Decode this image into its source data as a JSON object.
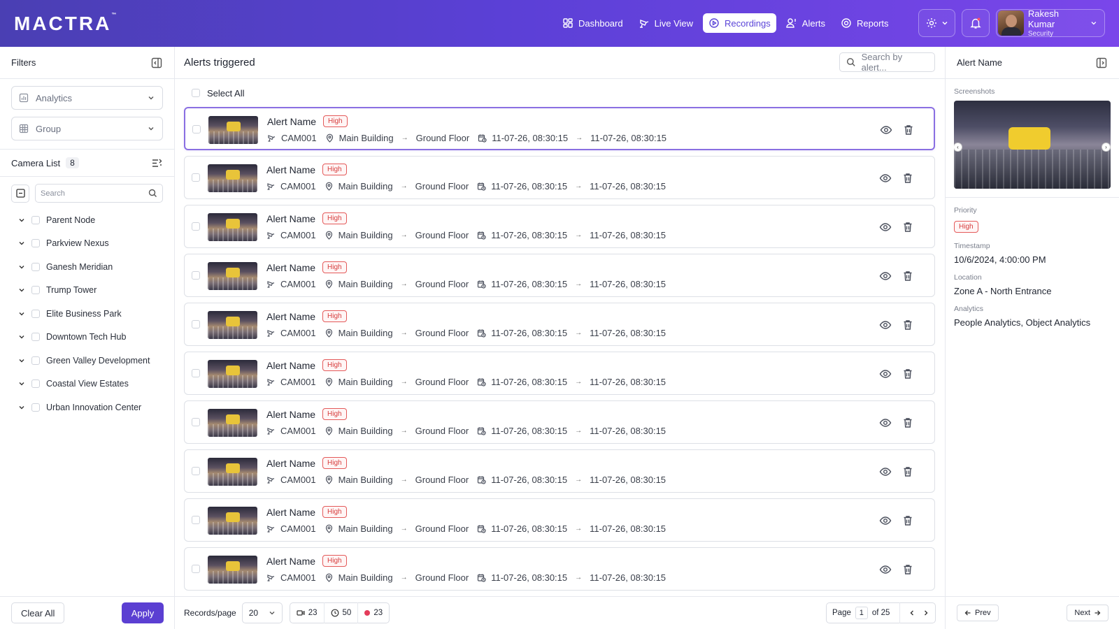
{
  "brand": {
    "logo": "MACTRA",
    "tm": "™"
  },
  "nav": [
    {
      "label": "Dashboard",
      "icon": "dashboard-icon"
    },
    {
      "label": "Live View",
      "icon": "camera-icon"
    },
    {
      "label": "Recordings",
      "icon": "play-circle-icon",
      "active": true
    },
    {
      "label": "Alerts",
      "icon": "user-alert-icon"
    },
    {
      "label": "Reports",
      "icon": "target-icon"
    }
  ],
  "user": {
    "name": "Rakesh Kumar",
    "role": "Security"
  },
  "filters": {
    "title": "Filters",
    "analytics_label": "Analytics",
    "group_label": "Group",
    "camera_list_label": "Camera List",
    "camera_count": "8",
    "search_placeholder": "Search",
    "tree": [
      "Parent Node",
      "Parkview Nexus",
      "Ganesh Meridian",
      "Trump Tower",
      "Elite Business Park",
      "Downtown Tech Hub",
      "Green Valley Development",
      "Coastal View Estates",
      "Urban Innovation Center"
    ],
    "clear_label": "Clear All",
    "apply_label": "Apply"
  },
  "main": {
    "title": "Alerts triggered",
    "search_placeholder": "Search by alert...",
    "select_all": "Select All",
    "alerts": [
      {
        "name": "Alert Name",
        "priority": "High",
        "camera": "CAM001",
        "building": "Main Building",
        "floor": "Ground Floor",
        "start": "11-07-26, 08:30:15",
        "end": "11-07-26, 08:30:15"
      },
      {
        "name": "Alert Name",
        "priority": "High",
        "camera": "CAM001",
        "building": "Main Building",
        "floor": "Ground Floor",
        "start": "11-07-26, 08:30:15",
        "end": "11-07-26, 08:30:15"
      },
      {
        "name": "Alert Name",
        "priority": "High",
        "camera": "CAM001",
        "building": "Main Building",
        "floor": "Ground Floor",
        "start": "11-07-26, 08:30:15",
        "end": "11-07-26, 08:30:15"
      },
      {
        "name": "Alert Name",
        "priority": "High",
        "camera": "CAM001",
        "building": "Main Building",
        "floor": "Ground Floor",
        "start": "11-07-26, 08:30:15",
        "end": "11-07-26, 08:30:15"
      },
      {
        "name": "Alert Name",
        "priority": "High",
        "camera": "CAM001",
        "building": "Main Building",
        "floor": "Ground Floor",
        "start": "11-07-26, 08:30:15",
        "end": "11-07-26, 08:30:15"
      },
      {
        "name": "Alert Name",
        "priority": "High",
        "camera": "CAM001",
        "building": "Main Building",
        "floor": "Ground Floor",
        "start": "11-07-26, 08:30:15",
        "end": "11-07-26, 08:30:15"
      },
      {
        "name": "Alert Name",
        "priority": "High",
        "camera": "CAM001",
        "building": "Main Building",
        "floor": "Ground Floor",
        "start": "11-07-26, 08:30:15",
        "end": "11-07-26, 08:30:15"
      },
      {
        "name": "Alert Name",
        "priority": "High",
        "camera": "CAM001",
        "building": "Main Building",
        "floor": "Ground Floor",
        "start": "11-07-26, 08:30:15",
        "end": "11-07-26, 08:30:15"
      },
      {
        "name": "Alert Name",
        "priority": "High",
        "camera": "CAM001",
        "building": "Main Building",
        "floor": "Ground Floor",
        "start": "11-07-26, 08:30:15",
        "end": "11-07-26, 08:30:15"
      },
      {
        "name": "Alert Name",
        "priority": "High",
        "camera": "CAM001",
        "building": "Main Building",
        "floor": "Ground Floor",
        "start": "11-07-26, 08:30:15",
        "end": "11-07-26, 08:30:15"
      }
    ],
    "footer": {
      "records_label": "Records/page",
      "records_value": "20",
      "stat_cameras": "23",
      "stat_clock": "50",
      "stat_live": "23",
      "page_label": "Page",
      "page_value": "1",
      "of_label": "of 25"
    }
  },
  "detail": {
    "title": "Alert Name",
    "screenshots_label": "Screenshots",
    "priority_label": "Priority",
    "priority_value": "High",
    "timestamp_label": "Timestamp",
    "timestamp_value": "10/6/2024, 4:00:00 PM",
    "location_label": "Location",
    "location_value": "Zone A - North Entrance",
    "analytics_label": "Analytics",
    "analytics_value": "People Analytics, Object Analytics",
    "prev_label": "Prev",
    "next_label": "Next"
  },
  "colors": {
    "primary": "#5b3fd2",
    "priority_red": "#d63c3c",
    "header_start": "#4a3fb3",
    "header_end": "#7a46ea"
  }
}
